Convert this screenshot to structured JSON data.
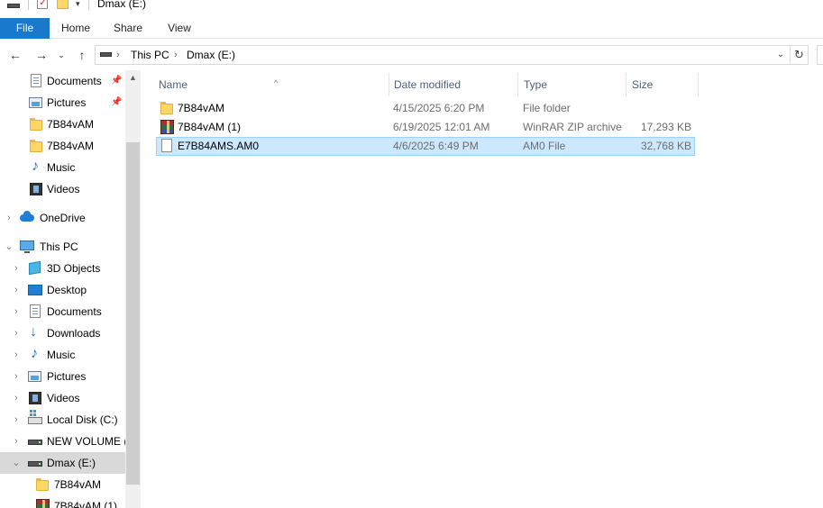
{
  "window": {
    "title": "Dmax (E:)"
  },
  "ribbon": {
    "tabs": [
      "File",
      "Home",
      "Share",
      "View"
    ]
  },
  "address": {
    "parts": [
      "This PC",
      "Dmax (E:)"
    ]
  },
  "nav": {
    "items": [
      {
        "label": "Documents",
        "icon": "documents-icon",
        "pinned": true
      },
      {
        "label": "Pictures",
        "icon": "pictures-icon",
        "pinned": true
      },
      {
        "label": "7B84vAM",
        "icon": "folder-icon"
      },
      {
        "label": "7B84vAM",
        "icon": "folder-icon"
      },
      {
        "label": "Music",
        "icon": "music-icon"
      },
      {
        "label": "Videos",
        "icon": "videos-icon"
      },
      {
        "label": "OneDrive",
        "icon": "onedrive-icon"
      },
      {
        "label": "This PC",
        "icon": "this-pc-icon"
      },
      {
        "label": "3D Objects",
        "icon": "3d-objects-icon"
      },
      {
        "label": "Desktop",
        "icon": "desktop-icon"
      },
      {
        "label": "Documents",
        "icon": "documents-icon"
      },
      {
        "label": "Downloads",
        "icon": "downloads-icon"
      },
      {
        "label": "Music",
        "icon": "music-icon"
      },
      {
        "label": "Pictures",
        "icon": "pictures-icon"
      },
      {
        "label": "Videos",
        "icon": "videos-icon"
      },
      {
        "label": "Local Disk (C:)",
        "icon": "local-disk-icon"
      },
      {
        "label": "NEW VOLUME (D:)",
        "icon": "drive-icon"
      },
      {
        "label": "Dmax (E:)",
        "icon": "drive-icon",
        "selected": true
      },
      {
        "label": "7B84vAM",
        "icon": "folder-icon"
      },
      {
        "label": "7B84vAM (1)",
        "icon": "winrar-icon"
      }
    ]
  },
  "columns": {
    "name": "Name",
    "date": "Date modified",
    "type": "Type",
    "size": "Size"
  },
  "files": [
    {
      "name": "7B84vAM",
      "date": "4/15/2025 6:20 PM",
      "type": "File folder",
      "size": "",
      "icon": "folder-icon"
    },
    {
      "name": "7B84vAM (1)",
      "date": "6/19/2025 12:01 AM",
      "type": "WinRAR ZIP archive",
      "size": "17,293 KB",
      "icon": "winrar-icon"
    },
    {
      "name": "E7B84AMS.AM0",
      "date": "4/6/2025 6:49 PM",
      "type": "AM0 File",
      "size": "32,768 KB",
      "icon": "file-icon",
      "selected": true
    }
  ],
  "colors": {
    "accent": "#1979ca",
    "selection": "#cce8ff",
    "selection_border": "#99d1ff",
    "header_text": "#4c607a"
  }
}
